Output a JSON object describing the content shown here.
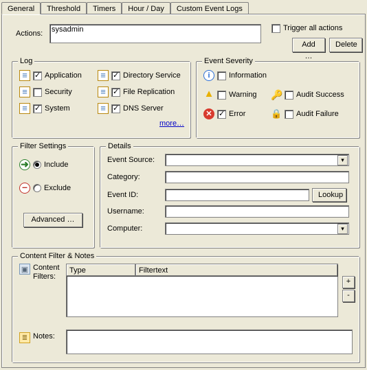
{
  "tabs": [
    "General",
    "Threshold",
    "Timers",
    "Hour / Day",
    "Custom Event Logs"
  ],
  "active_tab": 0,
  "actions": {
    "label": "Actions:",
    "value": "sysadmin",
    "trigger_all_label": "Trigger all actions",
    "trigger_all_checked": false,
    "add_label": "Add …",
    "delete_label": "Delete"
  },
  "log": {
    "legend": "Log",
    "items": [
      {
        "label": "Application",
        "checked": true
      },
      {
        "label": "Security",
        "checked": false
      },
      {
        "label": "System",
        "checked": true
      },
      {
        "label": "Directory Service",
        "checked": true
      },
      {
        "label": "File Replication",
        "checked": true
      },
      {
        "label": "DNS Server",
        "checked": true
      }
    ],
    "more_label": "more…"
  },
  "severity": {
    "legend": "Event Severity",
    "items": [
      {
        "icon": "info",
        "label": "Information",
        "checked": false
      },
      {
        "icon": "warn",
        "label": "Warning",
        "checked": false
      },
      {
        "icon": "err",
        "label": "Error",
        "checked": true
      },
      {
        "icon": "key",
        "label": "Audit Success",
        "checked": false
      },
      {
        "icon": "lock",
        "label": "Audit Failure",
        "checked": false
      }
    ]
  },
  "filter_settings": {
    "legend": "Filter Settings",
    "include_label": "Include",
    "exclude_label": "Exclude",
    "selected": "include",
    "advanced_label": "Advanced …"
  },
  "details": {
    "legend": "Details",
    "event_source": {
      "label": "Event Source:",
      "value": ""
    },
    "category": {
      "label": "Category:",
      "value": ""
    },
    "event_id": {
      "label": "Event ID:",
      "value": "",
      "lookup_label": "Lookup"
    },
    "username": {
      "label": "Username:",
      "value": ""
    },
    "computer": {
      "label": "Computer:",
      "value": ""
    }
  },
  "content_filter": {
    "legend": "Content Filter & Notes",
    "filters_label": "Content\nFilters:",
    "columns": [
      "Type",
      "Filtertext"
    ],
    "rows": [],
    "notes_label": "Notes:",
    "notes_value": ""
  }
}
